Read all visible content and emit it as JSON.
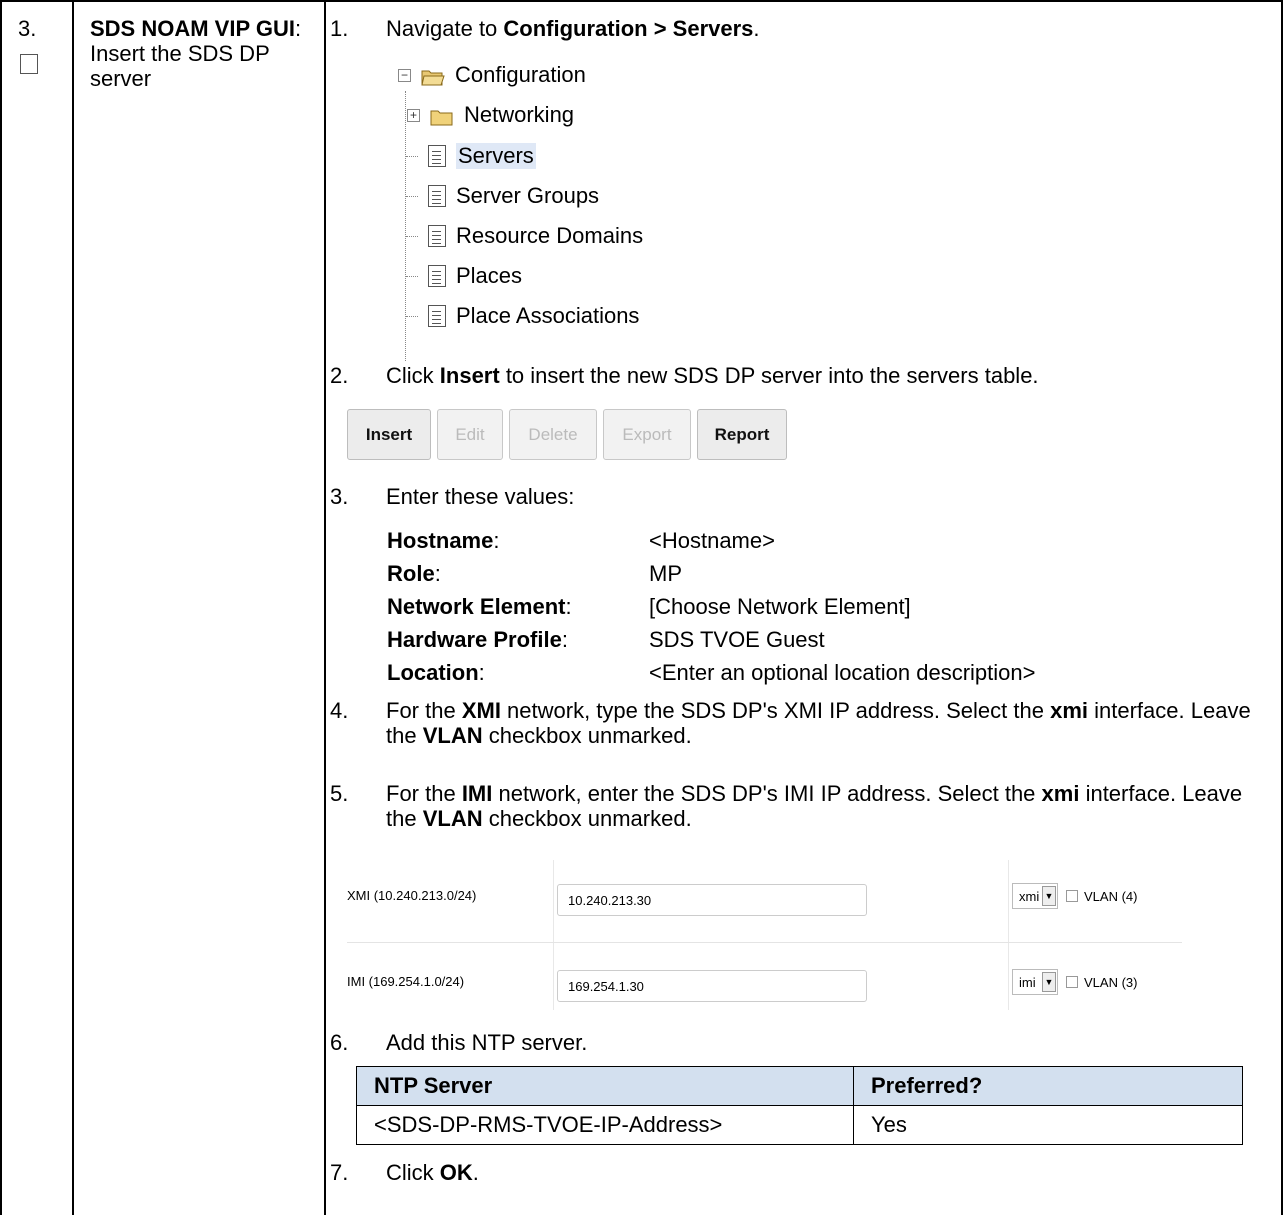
{
  "step": {
    "number": "3.",
    "title_bold": "SDS NOAM VIP GUI",
    "title_rest": ": Insert the SDS DP server"
  },
  "instructions": [
    {
      "num": "1.",
      "pre": "Navigate to ",
      "bold": "Configuration > Servers",
      "post": "."
    },
    {
      "num": "2.",
      "pre": "Click ",
      "bold": "Insert",
      "post": " to insert the new SDS DP server into the servers table."
    },
    {
      "num": "3.",
      "text": "Enter these values:"
    },
    {
      "num": "4.",
      "p1": "For the ",
      "b1": "XMI",
      "p2": " network, type the SDS DP's XMI IP address.  Select the ",
      "b2": "xmi",
      "p3": " interface.  Leave the ",
      "b3": "VLAN",
      "p4": " checkbox unmarked."
    },
    {
      "num": "5.",
      "p1": "For the ",
      "b1": "IMI",
      "p2": " network, enter the SDS DP's IMI IP address.  Select the ",
      "b2": "xmi",
      "p3": " interface.  Leave the ",
      "b3": "VLAN",
      "p4": " checkbox unmarked."
    },
    {
      "num": "6.",
      "text": "Add this NTP server."
    },
    {
      "num": "7.",
      "pre": "Click ",
      "bold": "OK",
      "post": "."
    }
  ],
  "tree": {
    "root": "Configuration",
    "items": [
      "Networking",
      "Servers",
      "Server Groups",
      "Resource Domains",
      "Places",
      "Place Associations"
    ],
    "selected": "Servers"
  },
  "buttons": [
    {
      "label": "Insert",
      "enabled": true
    },
    {
      "label": "Edit",
      "enabled": false
    },
    {
      "label": "Delete",
      "enabled": false
    },
    {
      "label": "Export",
      "enabled": false
    },
    {
      "label": "Report",
      "enabled": true
    }
  ],
  "values": [
    {
      "label": "Hostname",
      "value": "<Hostname>"
    },
    {
      "label": "Role",
      "value": "MP"
    },
    {
      "label": "Network Element",
      "value": "[Choose Network Element]"
    },
    {
      "label": "Hardware Profile",
      "value": "SDS TVOE Guest"
    },
    {
      "label": "Location",
      "value": "<Enter an optional location description>"
    }
  ],
  "networks": [
    {
      "label": "XMI (10.240.213.0/24)",
      "ip": "10.240.213.30",
      "interface": "xmi",
      "vlan": "VLAN (4)",
      "vlan_checked": false
    },
    {
      "label": "IMI (169.254.1.0/24)",
      "ip": "169.254.1.30",
      "interface": "imi",
      "vlan": "VLAN (3)",
      "vlan_checked": false
    }
  ],
  "ntp_table": {
    "headers": [
      "NTP Server",
      "Preferred?"
    ],
    "rows": [
      [
        "<SDS-DP-RMS-TVOE-IP-Address>",
        "Yes"
      ]
    ]
  },
  "colors": {
    "header_fill": "#d3e0ef",
    "selection": "#dfe8f6"
  }
}
